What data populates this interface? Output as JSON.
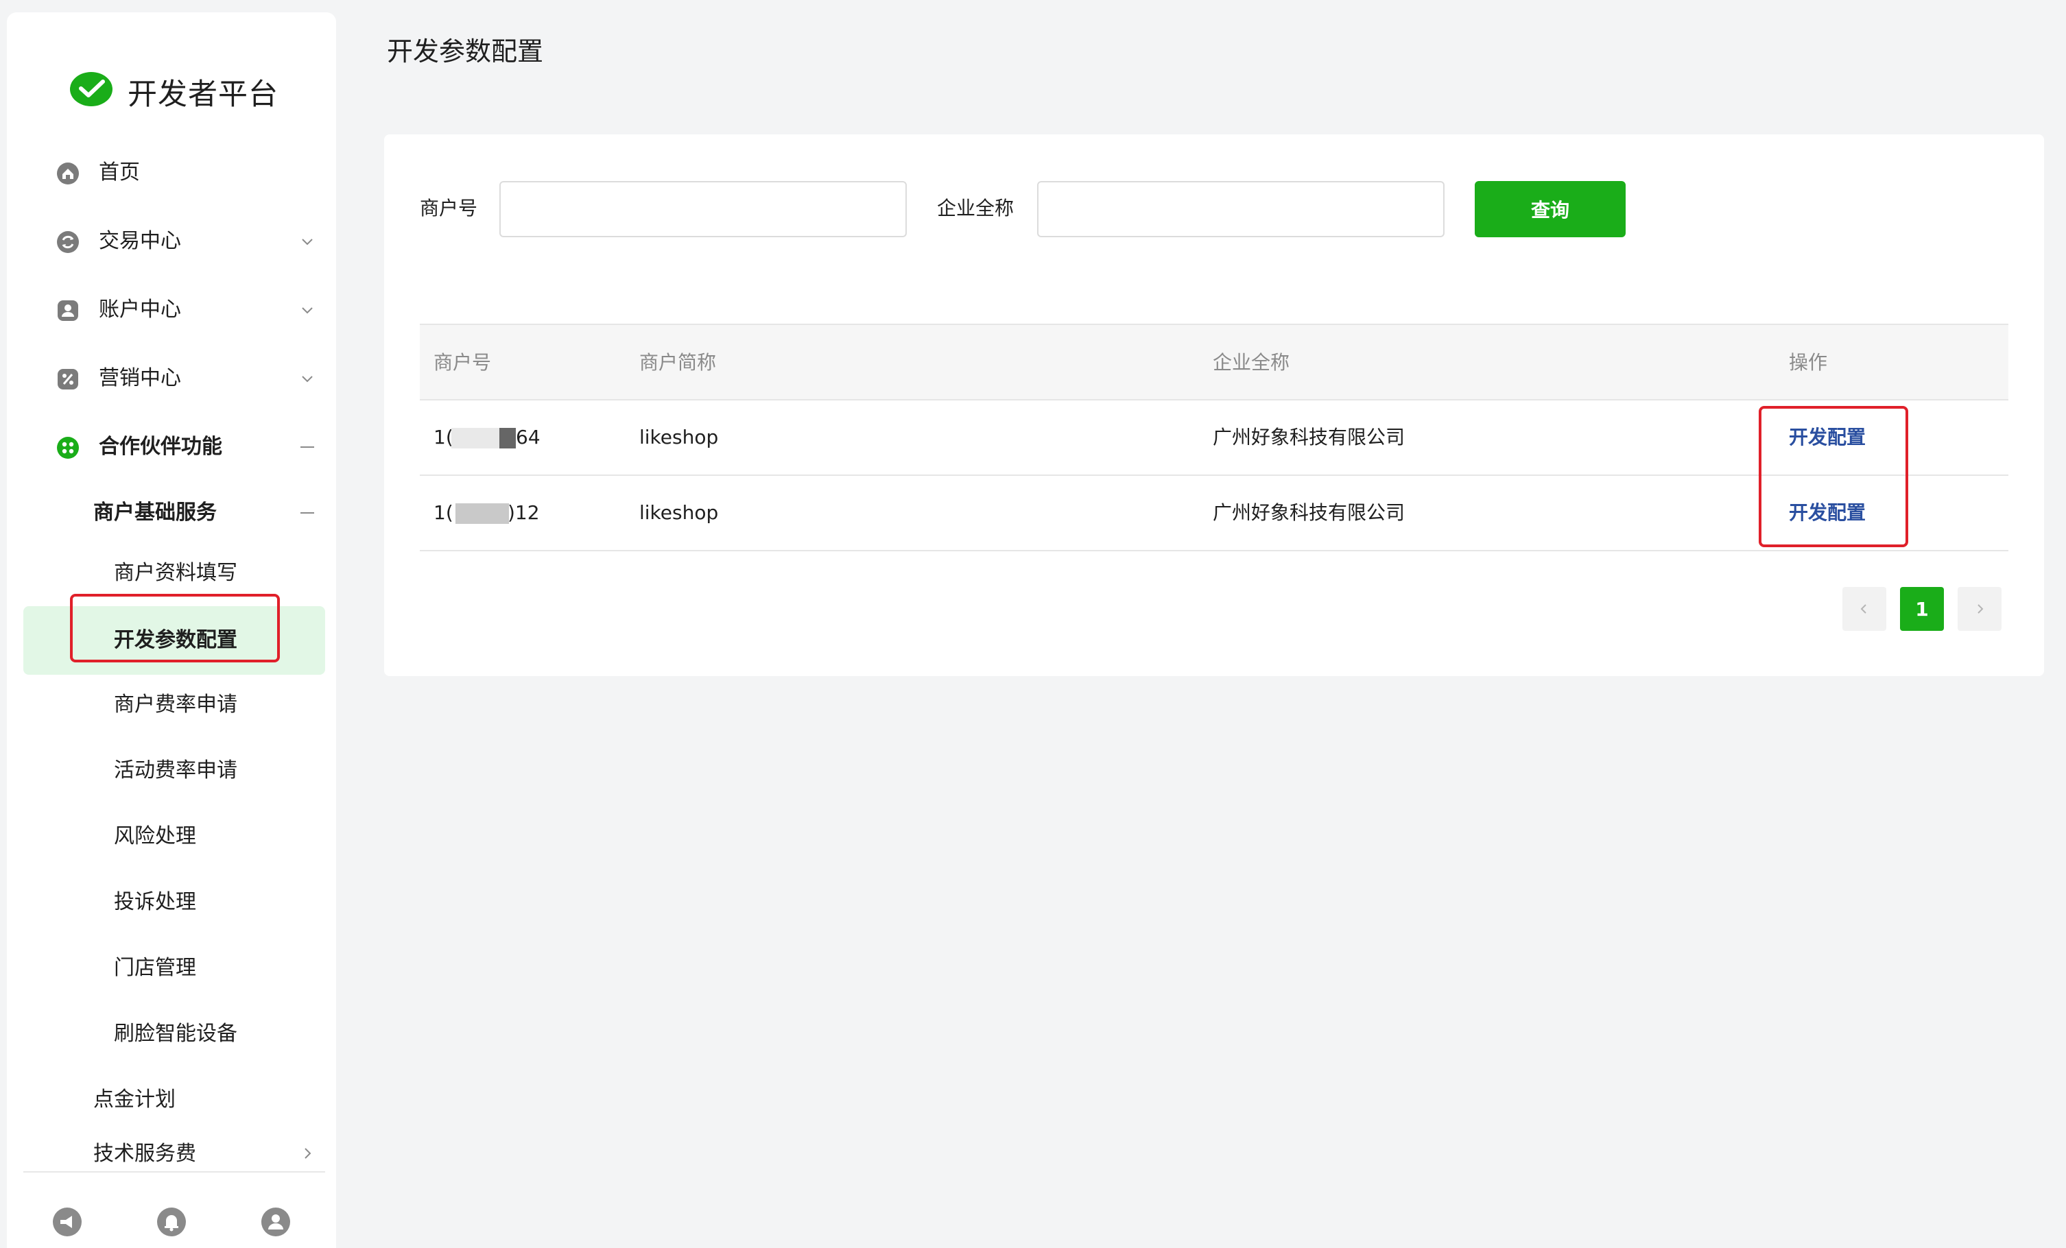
{
  "brand": {
    "title": "开发者平台"
  },
  "sidebar": {
    "items": [
      {
        "label": "首页",
        "icon": "home-icon"
      },
      {
        "label": "交易中心",
        "icon": "exchange-icon"
      },
      {
        "label": "账户中心",
        "icon": "account-icon"
      },
      {
        "label": "营销中心",
        "icon": "marketing-icon"
      },
      {
        "label": "合作伙伴功能",
        "icon": "partner-icon"
      }
    ],
    "sub_group": "商户基础服务",
    "sub_items": [
      {
        "label": "商户资料填写"
      },
      {
        "label": "开发参数配置",
        "active": true
      },
      {
        "label": "商户费率申请"
      },
      {
        "label": "活动费率申请"
      },
      {
        "label": "风险处理"
      },
      {
        "label": "投诉处理"
      },
      {
        "label": "门店管理"
      },
      {
        "label": "刷脸智能设备"
      }
    ],
    "more_items": [
      {
        "label": "点金计划"
      },
      {
        "label": "技术服务费"
      }
    ],
    "footer_icons": [
      "megaphone-icon",
      "bell-icon",
      "user-icon"
    ]
  },
  "page": {
    "title": "开发参数配置"
  },
  "filters": {
    "merchant_no_label": "商户号",
    "merchant_no_value": "",
    "company_label": "企业全称",
    "company_value": "",
    "query_label": "查询"
  },
  "table": {
    "columns": [
      "商户号",
      "商户简称",
      "企业全称",
      "操作"
    ],
    "rows": [
      {
        "id_prefix": "1(",
        "id_suffix": "64",
        "short_name": "likeshop",
        "full_name": "广州好象科技有限公司",
        "action": "开发配置"
      },
      {
        "id_prefix": "1(",
        "id_suffix": ")12",
        "short_name": "likeshop",
        "full_name": "广州好象科技有限公司",
        "action": "开发配置"
      }
    ]
  },
  "pagination": {
    "current": "1",
    "prev": "‹",
    "next": "›"
  },
  "colors": {
    "brand_green": "#1aad19",
    "link_blue": "#2a4fa0",
    "annotation_red": "#e0202a",
    "active_bg": "#e2f7e6"
  }
}
